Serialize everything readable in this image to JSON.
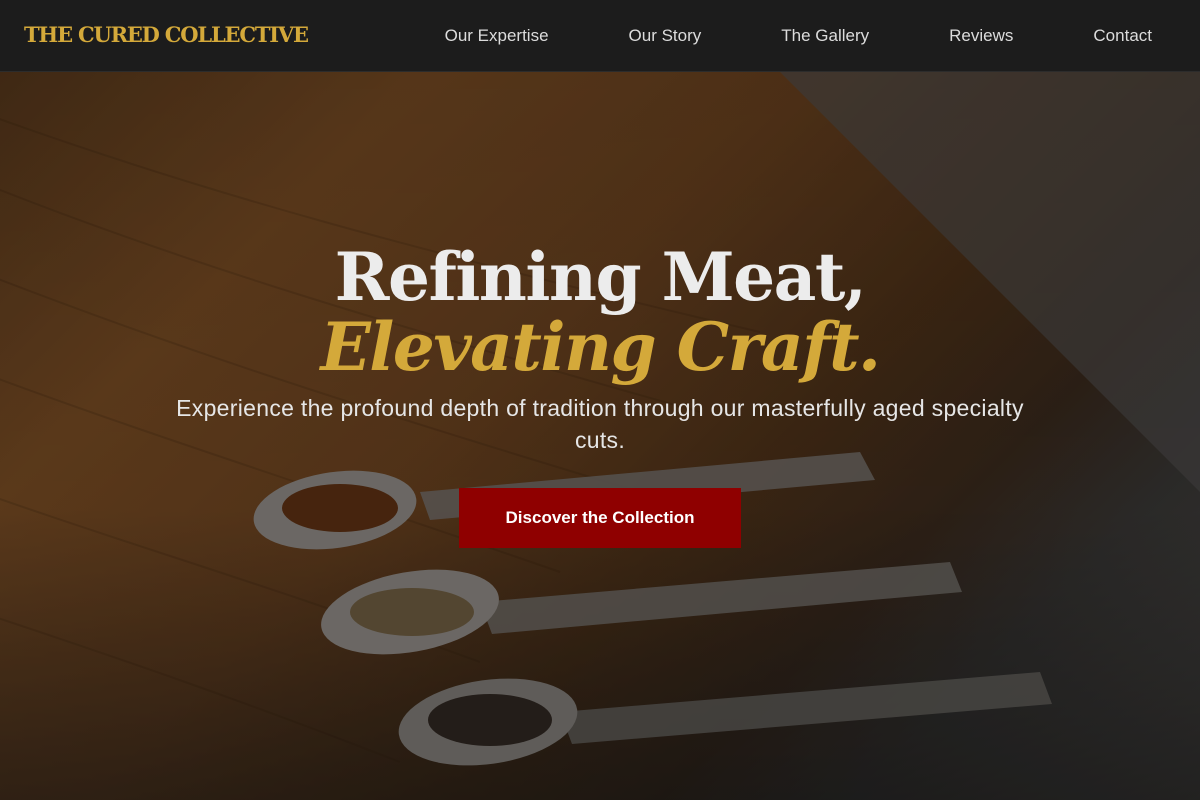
{
  "brand": {
    "name": "THE CURED COLLECTIVE"
  },
  "nav": {
    "items": [
      {
        "label": "Our Expertise"
      },
      {
        "label": "Our Story"
      },
      {
        "label": "The Gallery"
      },
      {
        "label": "Reviews"
      },
      {
        "label": "Contact"
      }
    ]
  },
  "hero": {
    "title_line1": "Refining Meat,",
    "title_line2": "Elevating Craft.",
    "subtitle": "Experience the profound depth of tradition through our masterfully aged specialty cuts.",
    "cta_label": "Discover the Collection"
  },
  "colors": {
    "accent_gold": "#d4a93a",
    "cta_red": "#8f0000",
    "nav_bg": "#1c1c1c"
  }
}
